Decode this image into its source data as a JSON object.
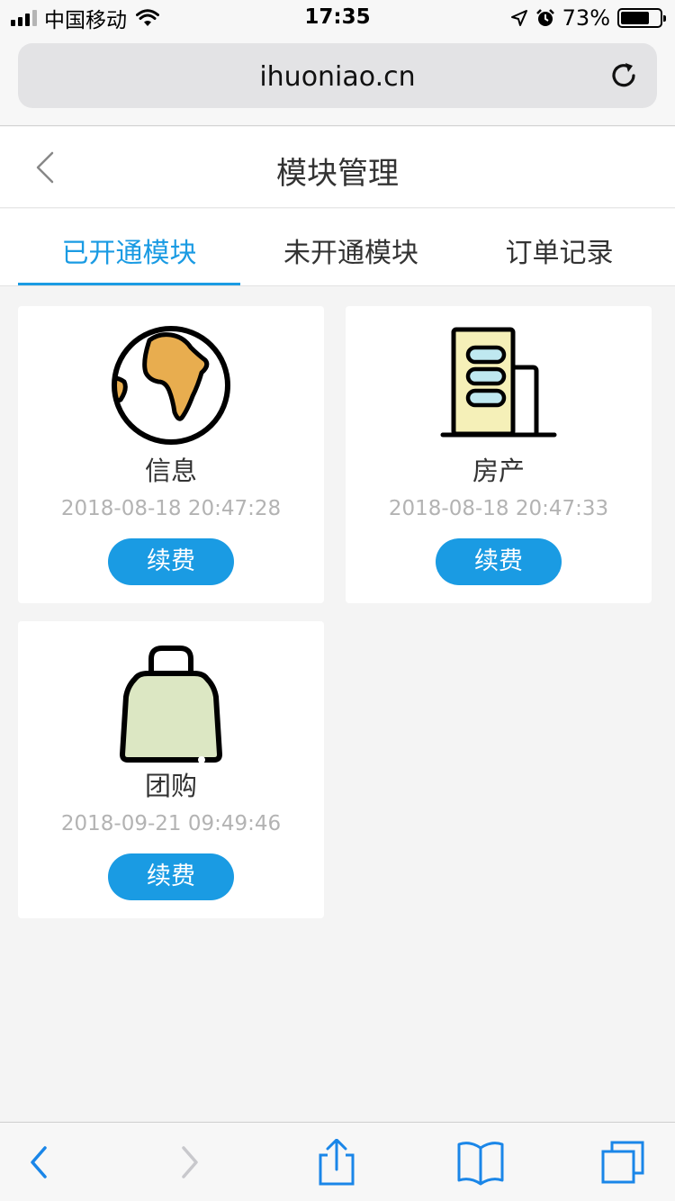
{
  "status_bar": {
    "carrier": "中国移动",
    "time": "17:35",
    "battery": "73%",
    "battery_level": 0.73,
    "signal_bars_active": 3,
    "signal_bars_total": 4
  },
  "browser": {
    "url": "ihuoniao.cn"
  },
  "header": {
    "title": "模块管理"
  },
  "tabs": [
    {
      "label": "已开通模块",
      "active": true
    },
    {
      "label": "未开通模块",
      "active": false
    },
    {
      "label": "订单记录",
      "active": false
    }
  ],
  "modules": [
    {
      "name": "信息",
      "date": "2018-08-18 20:47:28",
      "button": "续费",
      "icon": "globe-icon"
    },
    {
      "name": "房产",
      "date": "2018-08-18 20:47:33",
      "button": "续费",
      "icon": "building-icon"
    },
    {
      "name": "团购",
      "date": "2018-09-21 09:49:46",
      "button": "续费",
      "icon": "shopping-bag-icon"
    }
  ],
  "colors": {
    "accent": "#1a9be3",
    "background": "#f4f4f4",
    "card": "#ffffff",
    "date_text": "#b3b3b3",
    "globe_land": "#e8ad4f",
    "building_fill": "#f5f0b8",
    "window_fill": "#bfe8f0",
    "bag_fill": "#dce7c3"
  }
}
